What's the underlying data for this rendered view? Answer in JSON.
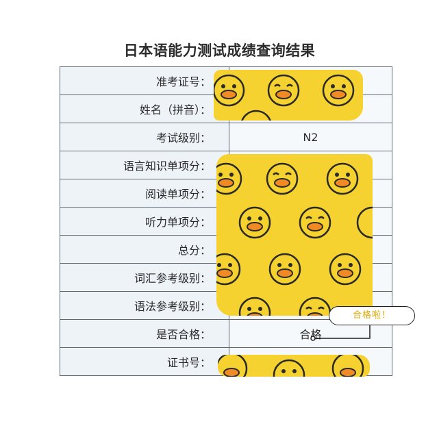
{
  "title": "日本语能力测试成绩查询结果",
  "rows": [
    {
      "label": "准考证号：",
      "value": ""
    },
    {
      "label": "姓名（拼音）：",
      "value": ""
    },
    {
      "label": "考试级别：",
      "value": "N2"
    },
    {
      "label": "语言知识单项分：",
      "value": ""
    },
    {
      "label": "阅读单项分：",
      "value": ""
    },
    {
      "label": "听力单项分：",
      "value": ""
    },
    {
      "label": "总分：",
      "value": ""
    },
    {
      "label": "词汇参考级别：",
      "value": ""
    },
    {
      "label": "语法参考级别：",
      "value": ""
    },
    {
      "label": "是否合格：",
      "value": "合格"
    },
    {
      "label": "证书号：",
      "value": ""
    }
  ],
  "annotation": {
    "text": "合格啦！"
  },
  "colors": {
    "mask_yellow": "#f6d230",
    "label_bg": "#eef3f8",
    "value_bg": "#f5f9fc",
    "border": "#5b6670",
    "tag_text": "#e0a800"
  }
}
